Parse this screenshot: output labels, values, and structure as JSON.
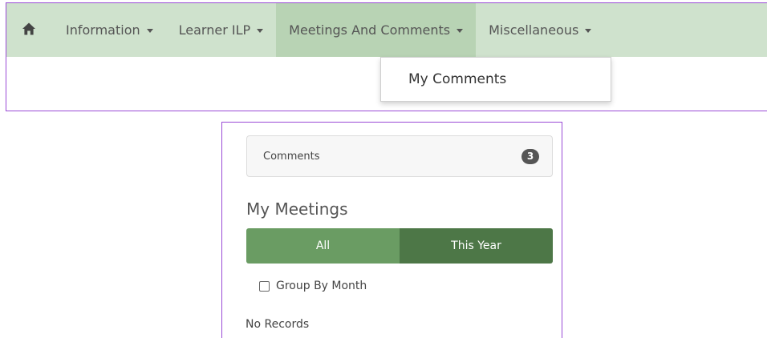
{
  "navbar": {
    "home_icon": "home-icon",
    "items": [
      {
        "label": "Information"
      },
      {
        "label": "Learner ILP"
      },
      {
        "label": "Meetings And Comments"
      },
      {
        "label": "Miscellaneous"
      }
    ],
    "active_index": 2,
    "colors": {
      "bar": "#cfe2cd",
      "active": "#b8d3b4",
      "outline": "#9a4ad6"
    }
  },
  "dropdown": {
    "items": [
      {
        "label": "My Comments"
      }
    ]
  },
  "comments": {
    "label": "Comments",
    "count": "3"
  },
  "meetings": {
    "title": "My Meetings",
    "filters": [
      {
        "label": "All"
      },
      {
        "label": "This Year"
      }
    ],
    "selected_filter": "This Year",
    "group_by_month_label": "Group By Month",
    "group_by_month_checked": false,
    "empty_text": "No Records",
    "colors": {
      "button": "#6a9c63",
      "button_active": "#4d7747"
    }
  }
}
